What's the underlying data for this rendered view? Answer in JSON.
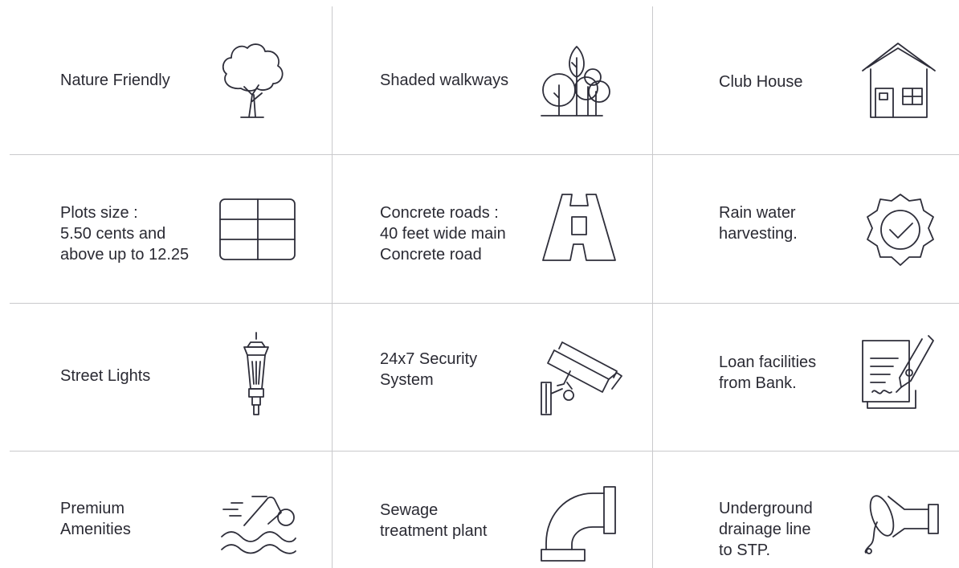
{
  "features": [
    {
      "key": "nature-friendly",
      "icon": "tree-icon",
      "lines": [
        "Nature Friendly"
      ]
    },
    {
      "key": "shaded-walkways",
      "icon": "trees-icon",
      "lines": [
        "Shaded walkways"
      ]
    },
    {
      "key": "club-house",
      "icon": "house-icon",
      "lines": [
        "Club House"
      ]
    },
    {
      "key": "plots-size",
      "icon": "plot-grid-icon",
      "lines": [
        "Plots size :",
        "5.50 cents and",
        "above up to 12.25"
      ]
    },
    {
      "key": "concrete-roads",
      "icon": "road-icon",
      "lines": [
        "Concrete roads :",
        "40 feet wide main",
        "Concrete road"
      ]
    },
    {
      "key": "rain-water-harvesting",
      "icon": "check-badge-icon",
      "lines": [
        "Rain water",
        "harvesting."
      ]
    },
    {
      "key": "street-lights",
      "icon": "street-lamp-icon",
      "lines": [
        "Street Lights"
      ]
    },
    {
      "key": "security-system",
      "icon": "cctv-camera-icon",
      "lines": [
        "24x7 Security",
        "System"
      ]
    },
    {
      "key": "loan-facilities",
      "icon": "document-pen-icon",
      "lines": [
        "Loan facilities",
        "from Bank."
      ]
    },
    {
      "key": "premium-amenities",
      "icon": "swimmer-icon",
      "lines": [
        "Premium",
        "Amenities"
      ]
    },
    {
      "key": "sewage-treatment",
      "icon": "pipe-elbow-icon",
      "lines": [
        "Sewage",
        "treatment plant"
      ]
    },
    {
      "key": "underground-drainage",
      "icon": "drain-pipe-icon",
      "lines": [
        "Underground",
        "drainage line",
        "to STP."
      ]
    }
  ],
  "colors": {
    "line": "#c9c9cc",
    "text": "#2a2a33",
    "icon": "#2e2e3a"
  }
}
